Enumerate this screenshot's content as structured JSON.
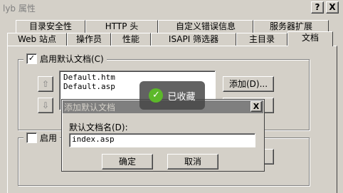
{
  "window": {
    "title": "lyb 属性",
    "help_label": "?",
    "close_label": "X"
  },
  "tabs_back": [
    "目录安全性",
    "HTTP 头",
    "自定义错误信息",
    "服务器扩展"
  ],
  "tabs_front": [
    "Web 站点",
    "操作员",
    "性能",
    "ISAPI 筛选器",
    "主目录",
    "文档"
  ],
  "documents": {
    "enable_default_label": "启用默认文档(C)",
    "enable_default_checked": true,
    "list": [
      "Default.htm",
      "Default.asp"
    ],
    "up_arrow": "⇧",
    "down_arrow": "⇩",
    "add_button": "添加(D)...",
    "footer_enable_label": "启用"
  },
  "toast": {
    "icon": "✓",
    "text": "已收藏"
  },
  "dialog": {
    "title": "添加默认文档",
    "close_label": "X",
    "field_label": "默认文档名(D):",
    "field_value": "index.asp",
    "ok_label": "确定",
    "cancel_label": "取消"
  }
}
